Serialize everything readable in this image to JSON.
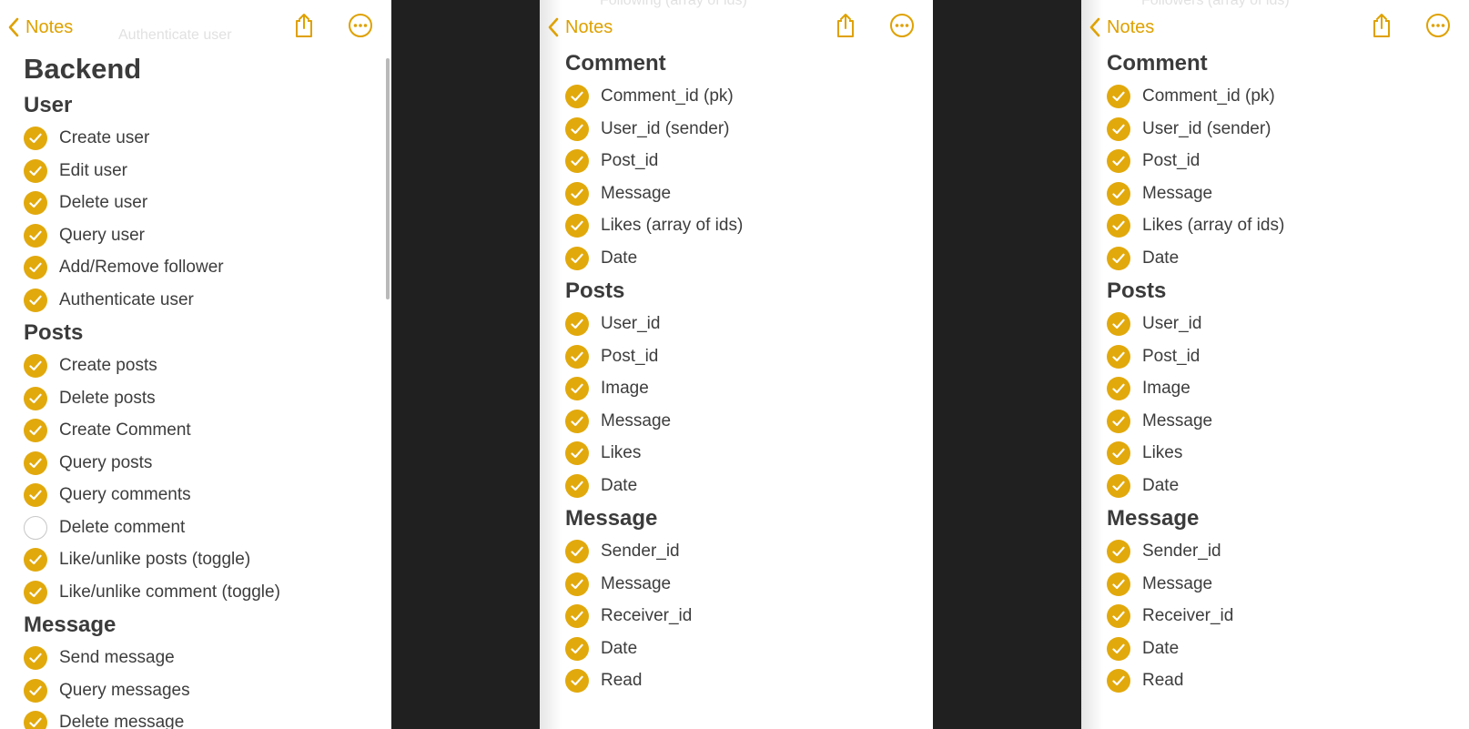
{
  "colors": {
    "accent": "#dfa100",
    "check_fill": "#e2a90c"
  },
  "nav": {
    "back_label": "Notes",
    "back_icon": "chevron-left-icon",
    "share_icon": "share-icon",
    "more_icon": "ellipsis-circle-icon"
  },
  "panel1": {
    "ghost_text": "Authenticate user",
    "title": "Backend",
    "sections": [
      {
        "title": "User",
        "items": [
          {
            "label": "Create user",
            "checked": true
          },
          {
            "label": "Edit user",
            "checked": true
          },
          {
            "label": "Delete user",
            "checked": true
          },
          {
            "label": "Query user",
            "checked": true
          },
          {
            "label": "Add/Remove follower",
            "checked": true
          },
          {
            "label": "Authenticate user",
            "checked": true
          }
        ]
      },
      {
        "title": "Posts",
        "items": [
          {
            "label": "Create posts",
            "checked": true
          },
          {
            "label": "Delete posts",
            "checked": true
          },
          {
            "label": "Create Comment",
            "checked": true
          },
          {
            "label": "Query posts",
            "checked": true
          },
          {
            "label": "Query comments",
            "checked": true
          },
          {
            "label": "Delete comment",
            "checked": false
          },
          {
            "label": "Like/unlike posts (toggle)",
            "checked": true
          },
          {
            "label": "Like/unlike comment (toggle)",
            "checked": true
          }
        ]
      },
      {
        "title": "Message",
        "items": [
          {
            "label": "Send message",
            "checked": true
          },
          {
            "label": "Query messages",
            "checked": true
          },
          {
            "label": "Delete message",
            "checked": true
          }
        ]
      }
    ]
  },
  "panel2": {
    "ghost_text": "Following (array of ids)",
    "sections": [
      {
        "title": "Comment",
        "items": [
          {
            "label": "Comment_id (pk)",
            "checked": true
          },
          {
            "label": "User_id (sender)",
            "checked": true
          },
          {
            "label": "Post_id",
            "checked": true
          },
          {
            "label": "Message",
            "checked": true
          },
          {
            "label": "Likes (array of ids)",
            "checked": true
          },
          {
            "label": "Date",
            "checked": true
          }
        ]
      },
      {
        "title": "Posts",
        "items": [
          {
            "label": "User_id",
            "checked": true
          },
          {
            "label": "Post_id",
            "checked": true
          },
          {
            "label": "Image",
            "checked": true
          },
          {
            "label": "Message",
            "checked": true
          },
          {
            "label": "Likes",
            "checked": true
          },
          {
            "label": "Date",
            "checked": true
          }
        ]
      },
      {
        "title": "Message",
        "items": [
          {
            "label": "Sender_id",
            "checked": true
          },
          {
            "label": "Message",
            "checked": true
          },
          {
            "label": "Receiver_id",
            "checked": true
          },
          {
            "label": "Date",
            "checked": true
          },
          {
            "label": "Read",
            "checked": true
          }
        ]
      }
    ]
  },
  "panel3": {
    "ghost_text": "Followers (array of ids)",
    "sections": [
      {
        "title": "Comment",
        "items": [
          {
            "label": "Comment_id (pk)",
            "checked": true
          },
          {
            "label": "User_id (sender)",
            "checked": true
          },
          {
            "label": "Post_id",
            "checked": true
          },
          {
            "label": "Message",
            "checked": true
          },
          {
            "label": "Likes (array of ids)",
            "checked": true
          },
          {
            "label": "Date",
            "checked": true
          }
        ]
      },
      {
        "title": "Posts",
        "items": [
          {
            "label": "User_id",
            "checked": true
          },
          {
            "label": "Post_id",
            "checked": true
          },
          {
            "label": "Image",
            "checked": true
          },
          {
            "label": "Message",
            "checked": true
          },
          {
            "label": "Likes",
            "checked": true
          },
          {
            "label": "Date",
            "checked": true
          }
        ]
      },
      {
        "title": "Message",
        "items": [
          {
            "label": "Sender_id",
            "checked": true
          },
          {
            "label": "Message",
            "checked": true
          },
          {
            "label": "Receiver_id",
            "checked": true
          },
          {
            "label": "Date",
            "checked": true
          },
          {
            "label": "Read",
            "checked": true
          }
        ]
      }
    ]
  }
}
